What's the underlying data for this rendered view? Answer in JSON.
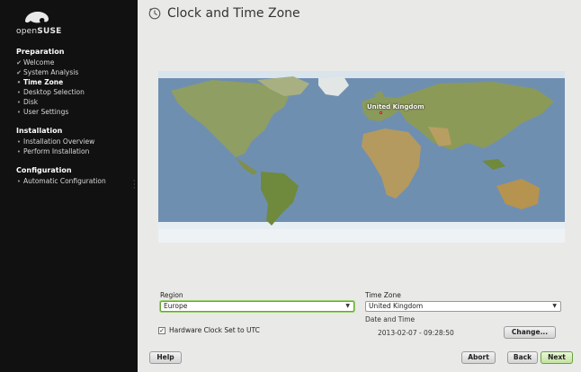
{
  "sidebar": {
    "logo": {
      "prefix": "open",
      "brand": "SUSE"
    },
    "sections": [
      {
        "title": "Preparation",
        "steps": [
          {
            "label": "Welcome",
            "state": "done"
          },
          {
            "label": "System Analysis",
            "state": "done"
          },
          {
            "label": "Time Zone",
            "state": "current"
          },
          {
            "label": "Desktop Selection",
            "state": "pending"
          },
          {
            "label": "Disk",
            "state": "pending"
          },
          {
            "label": "User Settings",
            "state": "pending"
          }
        ]
      },
      {
        "title": "Installation",
        "steps": [
          {
            "label": "Installation Overview",
            "state": "pending"
          },
          {
            "label": "Perform Installation",
            "state": "pending"
          }
        ]
      },
      {
        "title": "Configuration",
        "steps": [
          {
            "label": "Automatic Configuration",
            "state": "pending"
          }
        ]
      }
    ]
  },
  "header": {
    "title": "Clock and Time Zone",
    "icon": "clock-icon"
  },
  "map": {
    "marker_label": "United Kingdom"
  },
  "form": {
    "region_label": "Region",
    "region_value": "Europe",
    "timezone_label": "Time Zone",
    "timezone_value": "United Kingdom",
    "hw_clock_label": "Hardware Clock Set to UTC",
    "hw_clock_checked": true,
    "date_time_label": "Date and Time",
    "date_time_value": "2013-02-07 - 09:28:50",
    "change_label": "Change..."
  },
  "buttons": {
    "help": "Help",
    "abort": "Abort",
    "back": "Back",
    "next": "Next"
  },
  "colors": {
    "sidebar_bg": "#111111",
    "content_bg": "#e9e9e7",
    "accent_green": "#6aa33a",
    "ocean": "#6f8fb1"
  }
}
